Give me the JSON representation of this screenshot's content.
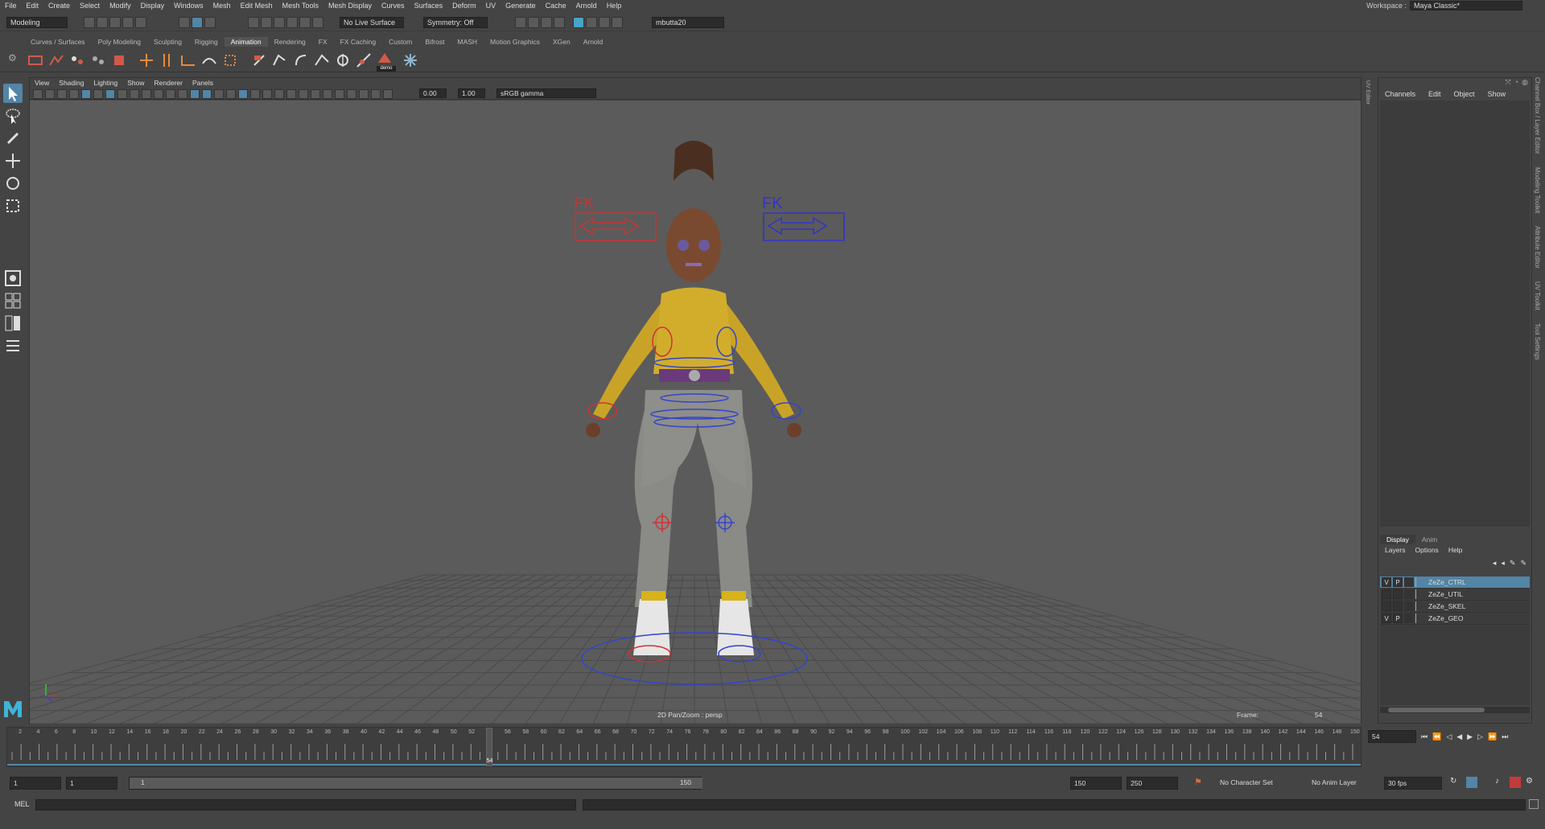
{
  "menubar": {
    "items": [
      "File",
      "Edit",
      "Create",
      "Select",
      "Modify",
      "Display",
      "Windows",
      "Mesh",
      "Edit Mesh",
      "Mesh Tools",
      "Mesh Display",
      "Curves",
      "Surfaces",
      "Deform",
      "UV",
      "Generate",
      "Cache",
      "Arnold",
      "Help"
    ],
    "workspace_label": "Workspace :",
    "workspace_value": "Maya Classic*"
  },
  "statusline": {
    "mode": "Modeling",
    "live_surface": "No Live Surface",
    "symmetry": "Symmetry: Off",
    "user": "mbutta20"
  },
  "shelf": {
    "tabs": [
      "Curves / Surfaces",
      "Poly Modeling",
      "Sculpting",
      "Rigging",
      "Animation",
      "Rendering",
      "FX",
      "FX Caching",
      "Custom",
      "Bifrost",
      "MASH",
      "Motion Graphics",
      "XGen",
      "Arnold"
    ],
    "active_tab": "Animation",
    "demo_label": "demo"
  },
  "viewport": {
    "menu": [
      "View",
      "Shading",
      "Lighting",
      "Show",
      "Renderer",
      "Panels"
    ],
    "exposure": "0.00",
    "gamma": "1.00",
    "color_space": "sRGB gamma",
    "camera_label": "2D Pan/Zoom : persp",
    "frame_label": "Frame:",
    "frame_value": "54",
    "fk_left": "FK",
    "fk_right": "FK"
  },
  "channel_box": {
    "menu": [
      "Channels",
      "Edit",
      "Object",
      "Show"
    ]
  },
  "layer_editor": {
    "tabs": [
      "Display",
      "Anim"
    ],
    "menu": [
      "Layers",
      "Options",
      "Help"
    ],
    "layers": [
      {
        "v": "V",
        "p": "P",
        "name": "ZeZe_CTRL"
      },
      {
        "v": "",
        "p": "",
        "name": "ZeZe_UTIL"
      },
      {
        "v": "",
        "p": "",
        "name": "ZeZe_SKEL"
      },
      {
        "v": "V",
        "p": "P",
        "name": "ZeZe_GEO"
      }
    ]
  },
  "side_tabs": [
    "Channel Box / Layer Editor",
    "Modeling Toolkit",
    "Attribute Editor",
    "UV Toolkit",
    "Tool Settings"
  ],
  "timeslider": {
    "ticks": [
      "2",
      "4",
      "6",
      "8",
      "10",
      "12",
      "14",
      "16",
      "18",
      "20",
      "22",
      "24",
      "26",
      "28",
      "30",
      "32",
      "34",
      "36",
      "38",
      "40",
      "42",
      "44",
      "46",
      "48",
      "50",
      "52",
      "54",
      "56",
      "58",
      "60",
      "62",
      "64",
      "66",
      "68",
      "70",
      "72",
      "74",
      "76",
      "78",
      "80",
      "82",
      "84",
      "86",
      "88",
      "90",
      "92",
      "94",
      "96",
      "98",
      "100",
      "102",
      "104",
      "106",
      "108",
      "110",
      "112",
      "114",
      "116",
      "118",
      "120",
      "122",
      "124",
      "126",
      "128",
      "130",
      "132",
      "134",
      "136",
      "138",
      "140",
      "142",
      "144",
      "146",
      "148",
      "150"
    ],
    "current_frame": "54",
    "current_frame_field": "54"
  },
  "range": {
    "start": "1",
    "start2": "1",
    "slider_start": "1",
    "slider_end": "150",
    "end": "150",
    "end2": "250",
    "character_set": "No Character Set",
    "anim_layer": "No Anim Layer",
    "fps": "30 fps"
  },
  "command": {
    "language": "MEL"
  }
}
